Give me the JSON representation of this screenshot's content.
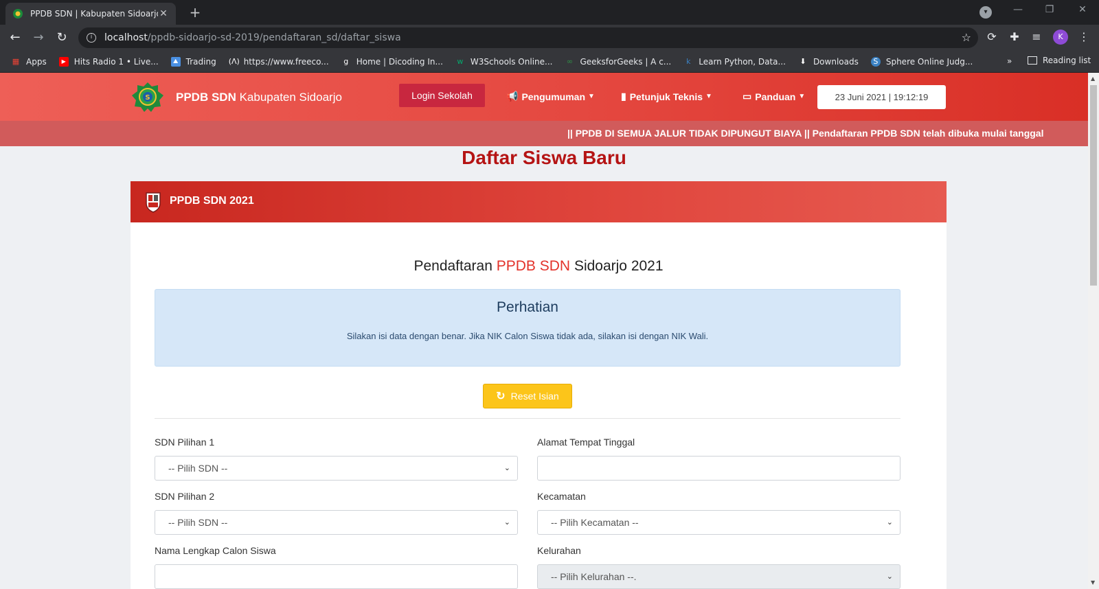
{
  "browser": {
    "tab_title": "PPDB SDN | Kabupaten Sidoarjo",
    "url_host": "localhost",
    "url_path": "/ppdb-sidoarjo-sd-2019/pendaftaran_sd/daftar_siswa",
    "avatar_letter": "K",
    "bookmarks": [
      {
        "label": "Apps",
        "icon": "apps-grid-icon",
        "color": "#ea4335"
      },
      {
        "label": "Hits Radio 1 • Live...",
        "icon": "youtube-icon",
        "color": "#ff0000"
      },
      {
        "label": "Trading",
        "icon": "trading-icon",
        "color": "#4a90e2"
      },
      {
        "label": "https://www.freeco...",
        "icon": "freecodecamp-icon",
        "color": "#ffffff"
      },
      {
        "label": "Home | Dicoding In...",
        "icon": "dicoding-icon",
        "color": "#ffffff"
      },
      {
        "label": "W3Schools Online...",
        "icon": "w3schools-icon",
        "color": "#04aa6d"
      },
      {
        "label": "GeeksforGeeks | A c...",
        "icon": "geeksforgeeks-icon",
        "color": "#2f8d46"
      },
      {
        "label": "Learn Python, Data...",
        "icon": "datacamp-icon",
        "color": "#03ef62"
      },
      {
        "label": "Downloads",
        "icon": "download-icon",
        "color": "#ffffff"
      },
      {
        "label": "Sphere Online Judg...",
        "icon": "spoj-icon",
        "color": "#3b82c4"
      }
    ],
    "more": "»",
    "reading_list": "Reading list"
  },
  "header": {
    "brand_bold": "PPDB SDN",
    "brand_rest": "Kabupaten Sidoarjo",
    "login": "Login Sekolah",
    "nav": [
      "Pengumuman",
      "Petunjuk Teknis",
      "Panduan"
    ],
    "datetime": "23 Juni 2021 | 19:12:19"
  },
  "marquee": "|| PPDB DI SEMUA JALUR TIDAK DIPUNGUT BIAYA || Pendaftaran PPDB SDN telah dibuka mulai tanggal",
  "page_title": "Daftar Siswa Baru",
  "card": {
    "title": "PPDB SDN 2021",
    "form_title_pre": "Pendaftaran",
    "form_title_hl": "PPDB SDN",
    "form_title_post": "Sidoarjo 2021",
    "alert_heading": "Perhatian",
    "alert_text": "Silakan isi data dengan benar. Jika NIK Calon Siswa tidak ada, silakan isi dengan NIK Wali.",
    "reset": "Reset Isian"
  },
  "form": {
    "sdn1_label": "SDN Pilihan 1",
    "sdn1_value": "-- Pilih SDN --",
    "sdn2_label": "SDN Pilihan 2",
    "sdn2_value": "-- Pilih SDN --",
    "nama_label": "Nama Lengkap Calon Siswa",
    "alamat_label": "Alamat Tempat Tinggal",
    "kecamatan_label": "Kecamatan",
    "kecamatan_value": "-- Pilih Kecamatan --",
    "kelurahan_label": "Kelurahan",
    "kelurahan_value": "-- Pilih Kelurahan --."
  },
  "colors": {
    "header_red": "#e4473f",
    "title_red": "#b51414",
    "login_btn": "#c8273f",
    "reset_btn": "#fcc51a",
    "alert_bg": "#d6e7f8"
  }
}
